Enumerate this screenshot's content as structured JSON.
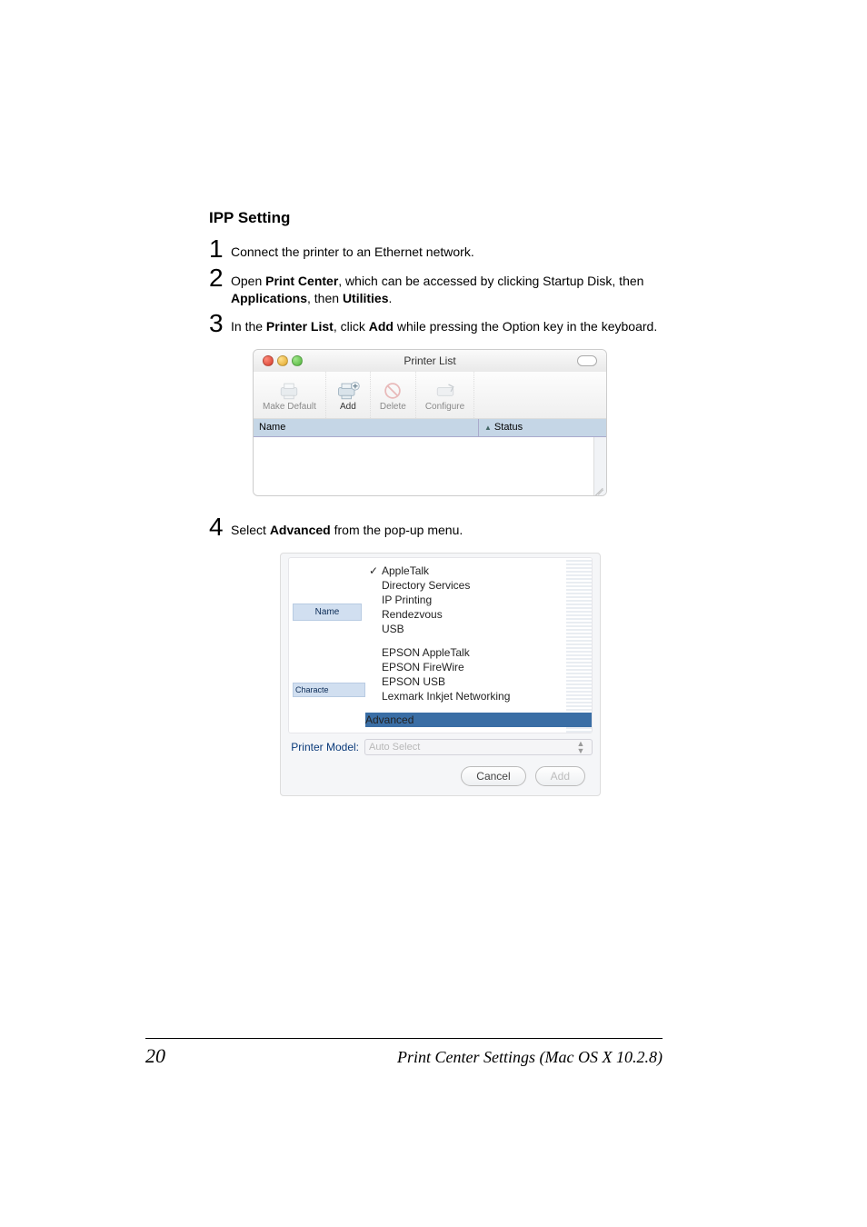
{
  "heading": "IPP Setting",
  "steps": {
    "s1_num": "1",
    "s1_a": "Connect the printer to an Ethernet network.",
    "s2_num": "2",
    "s2_a": "Open ",
    "s2_b": "Print Center",
    "s2_c": ", which can be accessed by clicking Startup Disk, then ",
    "s2_d": "Applications",
    "s2_e": ", then ",
    "s2_f": "Utilities",
    "s2_g": ".",
    "s3_num": "3",
    "s3_a": "In the ",
    "s3_b": "Printer List",
    "s3_c": ", click ",
    "s3_d": "Add",
    "s3_e": " while pressing the Option key in the keyboard.",
    "s4_num": "4",
    "s4_a": "Select ",
    "s4_b": "Advanced",
    "s4_c": " from the pop-up menu."
  },
  "printerList": {
    "title": "Printer List",
    "toolbar": {
      "makeDefault": "Make Default",
      "add": "Add",
      "delete": "Delete",
      "configure": "Configure"
    },
    "columns": {
      "name": "Name",
      "status": "Status"
    }
  },
  "advancedSheet": {
    "nameLabel": "Name",
    "characterLabel": "Characte",
    "menu": {
      "appleTalk": "AppleTalk",
      "directoryServices": "Directory Services",
      "ipPrinting": "IP Printing",
      "rendezvous": "Rendezvous",
      "usb": "USB",
      "epsonAppleTalk": "EPSON AppleTalk",
      "epsonFireWire": "EPSON FireWire",
      "epsonUsb": "EPSON USB",
      "lexmark": "Lexmark Inkjet Networking",
      "advanced": "Advanced"
    },
    "printerModelLabel": "Printer Model:",
    "printerModelValue": "Auto Select",
    "cancel": "Cancel",
    "add": "Add"
  },
  "footer": {
    "pageNum": "20",
    "title": "Print Center Settings (Mac OS X 10.2.8)"
  }
}
